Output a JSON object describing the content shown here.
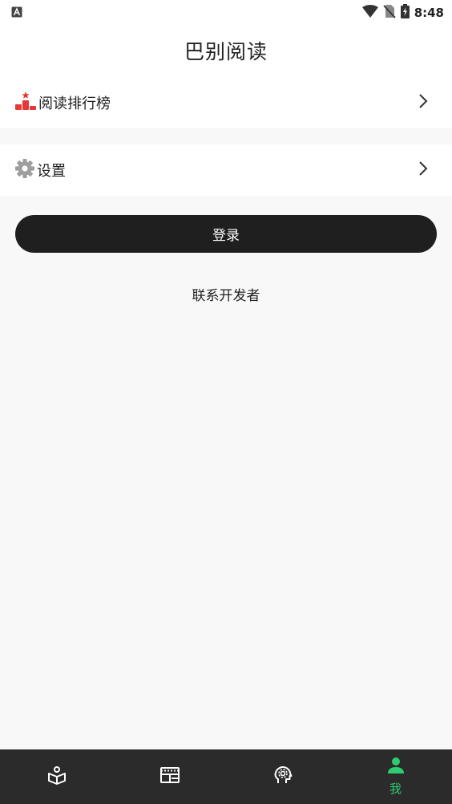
{
  "status_bar": {
    "time": "8:48",
    "left_icon": "a-notification-icon",
    "right_icons": [
      "wifi-icon",
      "no-sim-icon",
      "battery-icon"
    ]
  },
  "header": {
    "title": "巴别阅读"
  },
  "menu": [
    {
      "label": "阅读排行榜",
      "icon": "ranking-podium-icon"
    },
    {
      "label": "设置",
      "icon": "gear-icon"
    }
  ],
  "login": {
    "label": "登录"
  },
  "contact": {
    "label": "联系开发者"
  },
  "bottom_nav": {
    "items": [
      {
        "icon": "bookshelf-icon",
        "label": ""
      },
      {
        "icon": "discover-icon",
        "label": ""
      },
      {
        "icon": "brain-icon",
        "label": ""
      },
      {
        "icon": "person-icon",
        "label": "我",
        "active": true
      }
    ]
  },
  "colors": {
    "accent": "#2ecc71",
    "button_bg": "#1f1f1f",
    "nav_bg": "#2b2b2b",
    "page_bg": "#f8f8f8",
    "rank_red": "#e53935"
  }
}
